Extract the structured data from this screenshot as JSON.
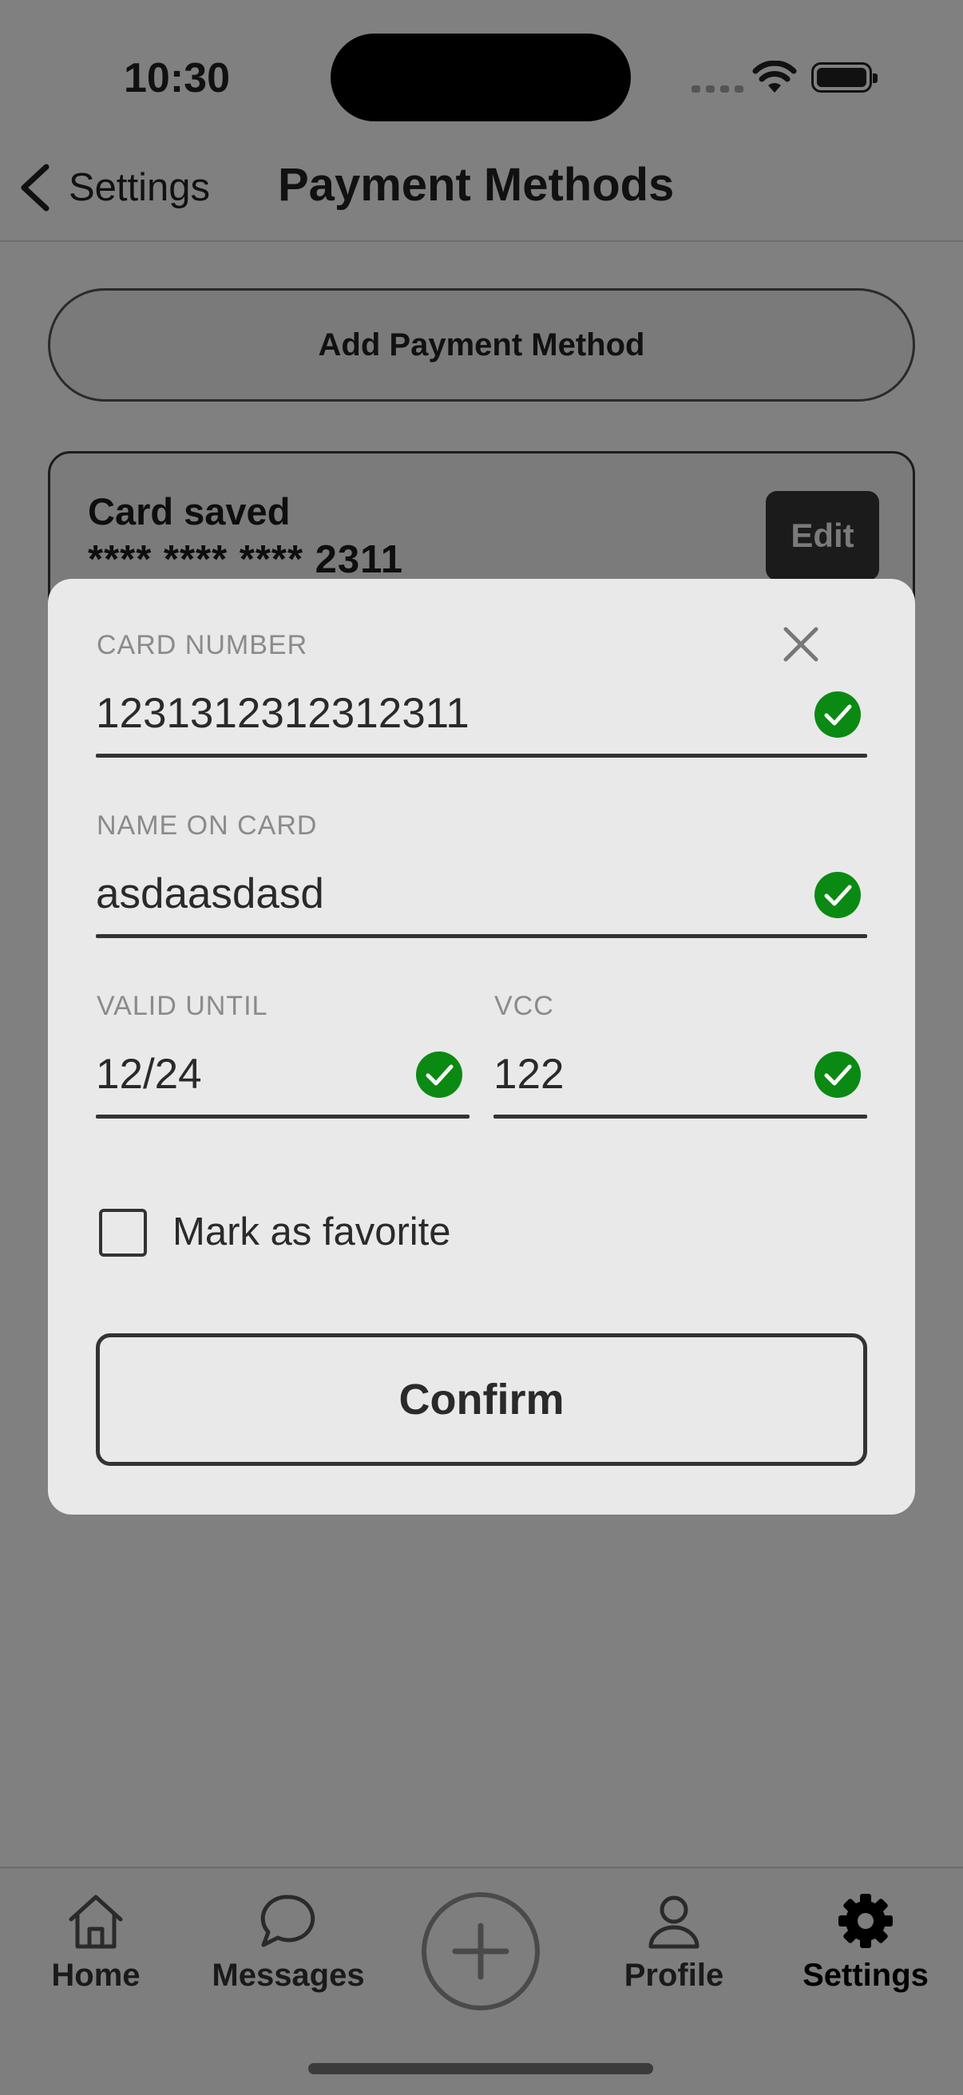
{
  "status_bar": {
    "time": "10:30"
  },
  "nav": {
    "back_label": "Settings",
    "title": "Payment Methods"
  },
  "add_button_label": "Add Payment Method",
  "saved_card": {
    "title": "Card saved",
    "number": "**** **** **** 2311",
    "edit_label": "Edit"
  },
  "form": {
    "card_number": {
      "label": "CARD NUMBER",
      "value": "1231312312312311"
    },
    "name_on_card": {
      "label": "NAME ON CARD",
      "value": "asdaasdasd"
    },
    "valid_until": {
      "label": "VALID UNTIL",
      "value": "12/24"
    },
    "vcc": {
      "label": "VCC",
      "value": "122"
    },
    "favorite_label": "Mark as favorite",
    "confirm_label": "Confirm"
  },
  "tabs": [
    {
      "label": "Home",
      "icon": "home-icon"
    },
    {
      "label": "Messages",
      "icon": "chat-bubble-icon"
    },
    {
      "label": "",
      "icon": "plus-circle-icon"
    },
    {
      "label": "Profile",
      "icon": "person-icon"
    },
    {
      "label": "Settings",
      "icon": "gear-icon",
      "active": true
    }
  ],
  "colors": {
    "valid_check": "#0a8a12",
    "overlay_gray": "#808080",
    "modal_bg": "#e9e9e9"
  }
}
